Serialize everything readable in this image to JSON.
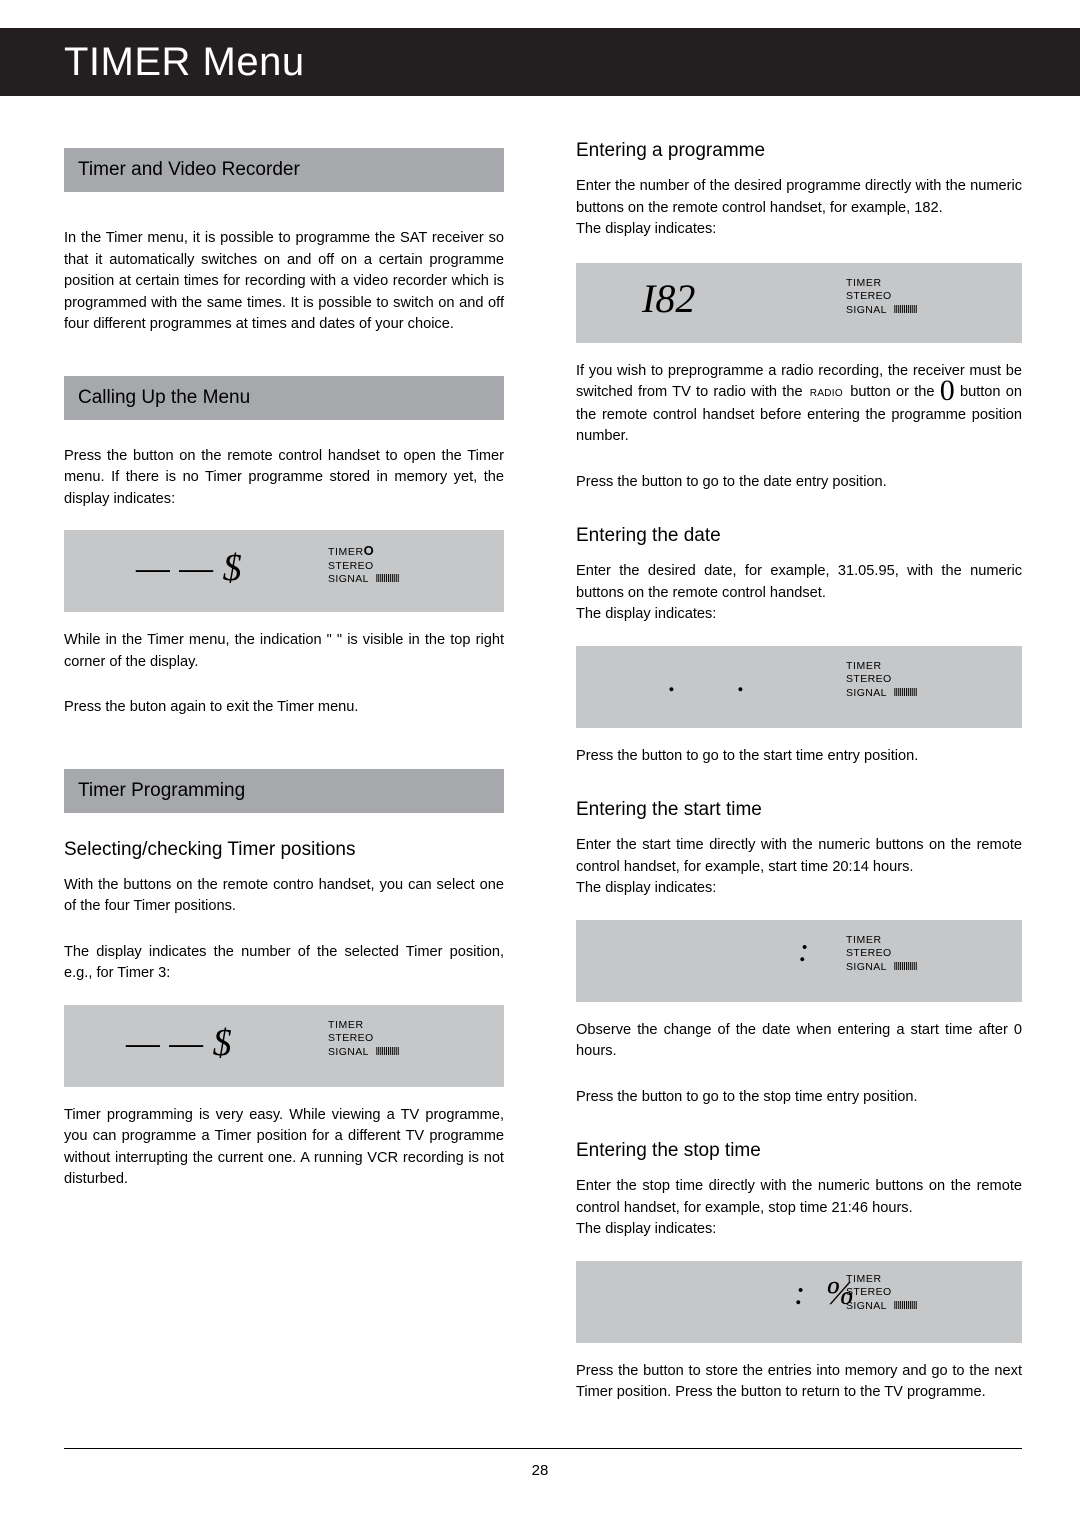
{
  "header": {
    "title": "TIMER Menu"
  },
  "left": {
    "bar1": "Timer and Video Recorder",
    "p1": "In the Timer menu, it is possible to programme the SAT receiver so that it automatically switches on and off on a certain programme position at certain times for recording with a video recorder which is programmed with the same times. It is possible to switch on and off four different programmes at times and dates of your choice.",
    "bar2": "Calling Up the Menu",
    "p2": "Press the          button on the remote control handset to open the Timer menu. If there is no Timer programme stored in memory yet, the display indicates:",
    "lcd1": {
      "main": "— —    $",
      "timer": "TIMER",
      "timer_extra": "O",
      "stereo": "STEREO",
      "signal": "SIGNAL",
      "bars": "llllllllllll"
    },
    "p3": "While in the Timer menu, the indication \"          \" is visible in the top right corner of the display.",
    "p4": "Press the          buton again to exit the Timer menu.",
    "bar3": "Timer Programming",
    "h1": "Selecting/checking Timer positions",
    "p5": "With the             buttons on the remote contro handset, you can select one of the four Timer positions.",
    "p6": "The display indicates the number of the selected Timer position, e.g., for Timer 3:",
    "lcd2": {
      "main": "— —    $",
      "timer": "TIMER",
      "stereo": "STEREO",
      "signal": "SIGNAL",
      "bars": "llllllllllll"
    },
    "p7": "Timer programming is very easy. While viewing a TV programme, you can programme a Timer position for a different TV programme without interrupting the current one. A running VCR recording is not disturbed."
  },
  "right": {
    "h1": "Entering a programme",
    "p1": "Enter the number of the desired programme directly with the numeric buttons on the remote control handset, for example, 182.",
    "p1b": "The display indicates:",
    "lcd1": {
      "main": "I82",
      "timer": "TIMER",
      "stereo": "STEREO",
      "signal": "SIGNAL",
      "bars": "llllllllllll"
    },
    "p2a": "If you wish to preprogramme a radio recording, the receiver must be switched from TV to radio with the",
    "p2_radio": "RADIO",
    "p2b": "button or the",
    "p2_zero": "0",
    "p2c": "button on the remote control handset before entering the programme position number.",
    "p3": "Press the          button to go to the date entry position.",
    "h2": "Entering the date",
    "p4": "Enter the desired date, for example, 31.05.95, with the numeric buttons on the remote control handset.",
    "p4b": "The display indicates:",
    "lcd2": {
      "main": ".      .",
      "timer": "TIMER",
      "stereo": "STEREO",
      "signal": "SIGNAL",
      "bars": "llllllllllll"
    },
    "p5": "Press the          button to go to the start time entry position.",
    "h3": "Entering the start time",
    "p6": "Enter the start time directly with the numeric buttons on the remote control handset, for example, start time 20:14 hours.",
    "p6b": "The display indicates:",
    "lcd3": {
      "main": ":",
      "timer": "TIMER",
      "stereo": "STEREO",
      "signal": "SIGNAL",
      "bars": "llllllllllll"
    },
    "p7": "Observe the change of the date when entering a start time after 0 hours.",
    "p8": "Press the          button to go to the stop time entry position.",
    "h4": "Entering the stop time",
    "p9": "Enter the stop time directly with the numeric buttons on the remote control handset, for example, stop time 21:46 hours.",
    "p9b": "The display indicates:",
    "lcd4": {
      "main": ": %",
      "timer": "TIMER",
      "stereo": "STEREO",
      "signal": "SIGNAL",
      "bars": "llllllllllll"
    },
    "p10": "Press the          button to store the entries into memory and go to the next Timer position. Press the            button to return to the TV programme."
  },
  "footer": {
    "page_number": "28"
  }
}
